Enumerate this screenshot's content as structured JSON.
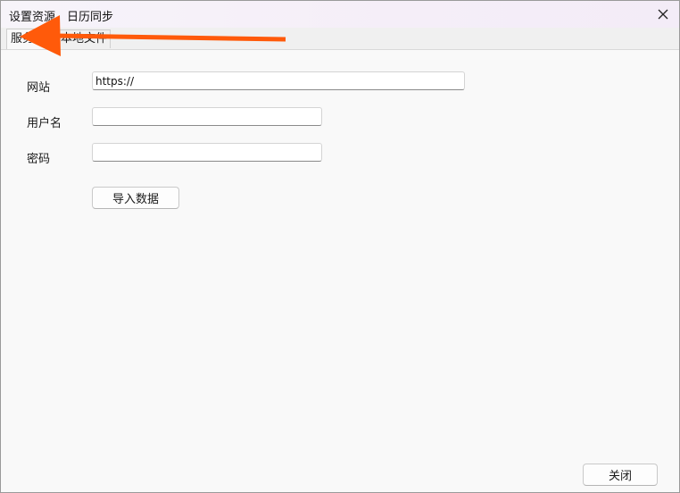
{
  "window": {
    "title": "设置资源、日历同步",
    "close_glyph": "✕"
  },
  "tabs": [
    {
      "label": "服务器",
      "active": true
    },
    {
      "label": "本地文件",
      "active": false
    }
  ],
  "form": {
    "website_label": "网站",
    "website_value": "https://",
    "username_label": "用户名",
    "username_value": "",
    "password_label": "密码",
    "password_value": ""
  },
  "buttons": {
    "import_label": "导入数据",
    "close_label": "关闭"
  },
  "annotation": {
    "arrow_color": "#ff5a0a",
    "icon": "arrow-left-icon"
  }
}
